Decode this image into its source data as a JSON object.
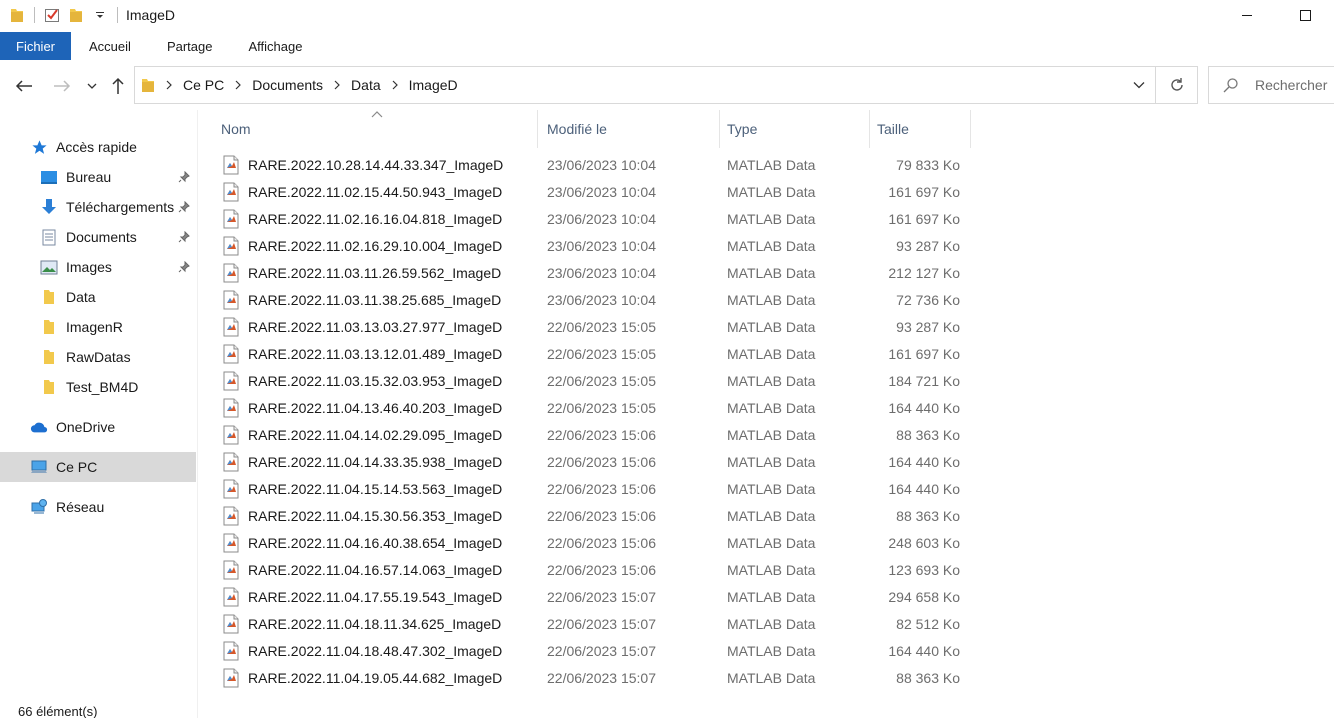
{
  "window": {
    "title": "ImageD",
    "accent_color": "#1e64b8"
  },
  "ribbon": {
    "tabs": [
      "Fichier",
      "Accueil",
      "Partage",
      "Affichage"
    ]
  },
  "address": {
    "breadcrumbs": [
      "Ce PC",
      "Documents",
      "Data",
      "ImageD"
    ],
    "search_placeholder": "Rechercher"
  },
  "sidebar": {
    "quick_access_label": "Accès rapide",
    "items": [
      {
        "label": "Bureau",
        "icon": "desktop-icon",
        "pinned": true
      },
      {
        "label": "Téléchargements",
        "icon": "download-icon",
        "pinned": true
      },
      {
        "label": "Documents",
        "icon": "documents-icon",
        "pinned": true
      },
      {
        "label": "Images",
        "icon": "pictures-icon",
        "pinned": true
      },
      {
        "label": "Data",
        "icon": "folder-icon",
        "pinned": false
      },
      {
        "label": "ImagenR",
        "icon": "folder-icon",
        "pinned": false
      },
      {
        "label": "RawDatas",
        "icon": "folder-icon",
        "pinned": false
      },
      {
        "label": "Test_BM4D",
        "icon": "folder-icon",
        "pinned": false
      }
    ],
    "onedrive_label": "OneDrive",
    "thispc_label": "Ce PC",
    "network_label": "Réseau"
  },
  "columns": {
    "name": "Nom",
    "modified": "Modifié le",
    "type": "Type",
    "size": "Taille"
  },
  "files": [
    {
      "name": "RARE.2022.10.28.14.44.33.347_ImageD",
      "modified": "23/06/2023 10:04",
      "type": "MATLAB Data",
      "size": "79 833 Ko"
    },
    {
      "name": "RARE.2022.11.02.15.44.50.943_ImageD",
      "modified": "23/06/2023 10:04",
      "type": "MATLAB Data",
      "size": "161 697 Ko"
    },
    {
      "name": "RARE.2022.11.02.16.16.04.818_ImageD",
      "modified": "23/06/2023 10:04",
      "type": "MATLAB Data",
      "size": "161 697 Ko"
    },
    {
      "name": "RARE.2022.11.02.16.29.10.004_ImageD",
      "modified": "23/06/2023 10:04",
      "type": "MATLAB Data",
      "size": "93 287 Ko"
    },
    {
      "name": "RARE.2022.11.03.11.26.59.562_ImageD",
      "modified": "23/06/2023 10:04",
      "type": "MATLAB Data",
      "size": "212 127 Ko"
    },
    {
      "name": "RARE.2022.11.03.11.38.25.685_ImageD",
      "modified": "23/06/2023 10:04",
      "type": "MATLAB Data",
      "size": "72 736 Ko"
    },
    {
      "name": "RARE.2022.11.03.13.03.27.977_ImageD",
      "modified": "22/06/2023 15:05",
      "type": "MATLAB Data",
      "size": "93 287 Ko"
    },
    {
      "name": "RARE.2022.11.03.13.12.01.489_ImageD",
      "modified": "22/06/2023 15:05",
      "type": "MATLAB Data",
      "size": "161 697 Ko"
    },
    {
      "name": "RARE.2022.11.03.15.32.03.953_ImageD",
      "modified": "22/06/2023 15:05",
      "type": "MATLAB Data",
      "size": "184 721 Ko"
    },
    {
      "name": "RARE.2022.11.04.13.46.40.203_ImageD",
      "modified": "22/06/2023 15:05",
      "type": "MATLAB Data",
      "size": "164 440 Ko"
    },
    {
      "name": "RARE.2022.11.04.14.02.29.095_ImageD",
      "modified": "22/06/2023 15:06",
      "type": "MATLAB Data",
      "size": "88 363 Ko"
    },
    {
      "name": "RARE.2022.11.04.14.33.35.938_ImageD",
      "modified": "22/06/2023 15:06",
      "type": "MATLAB Data",
      "size": "164 440 Ko"
    },
    {
      "name": "RARE.2022.11.04.15.14.53.563_ImageD",
      "modified": "22/06/2023 15:06",
      "type": "MATLAB Data",
      "size": "164 440 Ko"
    },
    {
      "name": "RARE.2022.11.04.15.30.56.353_ImageD",
      "modified": "22/06/2023 15:06",
      "type": "MATLAB Data",
      "size": "88 363 Ko"
    },
    {
      "name": "RARE.2022.11.04.16.40.38.654_ImageD",
      "modified": "22/06/2023 15:06",
      "type": "MATLAB Data",
      "size": "248 603 Ko"
    },
    {
      "name": "RARE.2022.11.04.16.57.14.063_ImageD",
      "modified": "22/06/2023 15:06",
      "type": "MATLAB Data",
      "size": "123 693 Ko"
    },
    {
      "name": "RARE.2022.11.04.17.55.19.543_ImageD",
      "modified": "22/06/2023 15:07",
      "type": "MATLAB Data",
      "size": "294 658 Ko"
    },
    {
      "name": "RARE.2022.11.04.18.11.34.625_ImageD",
      "modified": "22/06/2023 15:07",
      "type": "MATLAB Data",
      "size": "82 512 Ko"
    },
    {
      "name": "RARE.2022.11.04.18.48.47.302_ImageD",
      "modified": "22/06/2023 15:07",
      "type": "MATLAB Data",
      "size": "164 440 Ko"
    },
    {
      "name": "RARE.2022.11.04.19.05.44.682_ImageD",
      "modified": "22/06/2023 15:07",
      "type": "MATLAB Data",
      "size": "88 363 Ko"
    }
  ],
  "status": {
    "item_count": "66 élément(s)"
  }
}
